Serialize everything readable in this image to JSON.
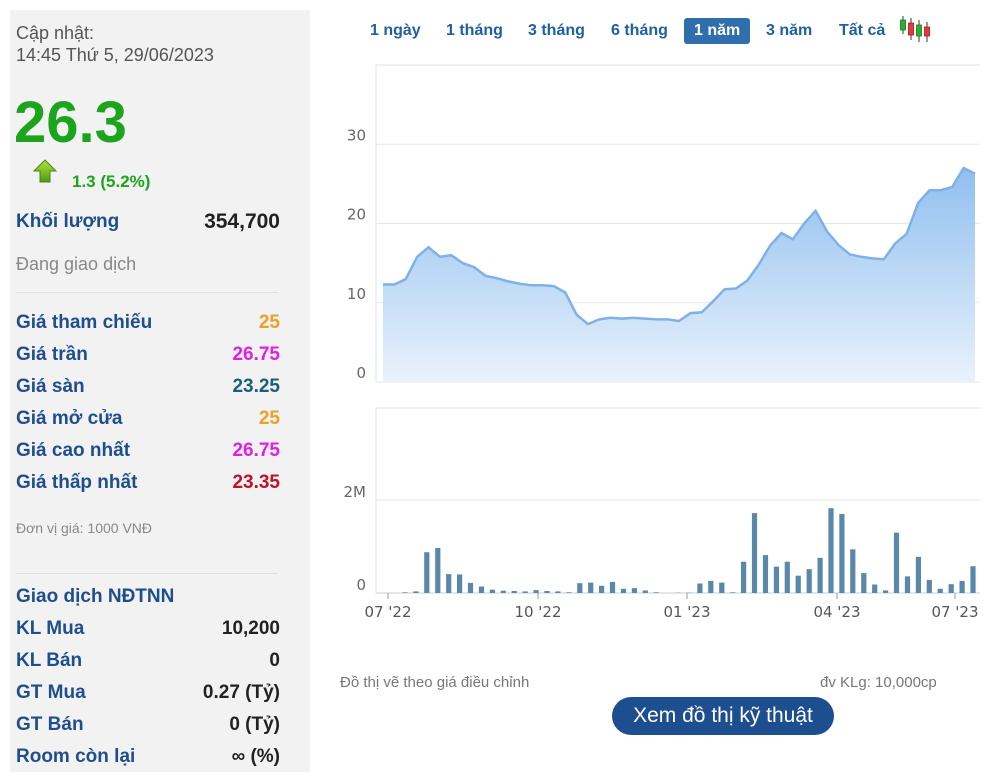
{
  "quote": {
    "updated_label": "Cập nhật:",
    "updated_time": "14:45 Thứ 5, 29/06/2023",
    "price": "26.3",
    "change": "1.3 (5.2%)",
    "volume_label": "Khối lượng",
    "volume": "354,700",
    "status": "Đang giao dịch",
    "unit_note": "Đơn vị giá: 1000 VNĐ",
    "colors": {
      "up": "#1ca51c",
      "reference": "#f0a020",
      "ceiling": "#e020e0",
      "floor": "#1a5f7a",
      "low": "#c0102a"
    }
  },
  "price_rows": [
    {
      "label": "Giá tham chiếu",
      "value": "25"
    },
    {
      "label": "Giá trần",
      "value": "26.75"
    },
    {
      "label": "Giá sàn",
      "value": "23.25"
    },
    {
      "label": "Giá mở cửa",
      "value": "25"
    },
    {
      "label": "Giá cao nhất",
      "value": "26.75"
    },
    {
      "label": "Giá thấp nhất",
      "value": "23.35"
    }
  ],
  "foreign": {
    "title": "Giao dịch NĐTNN",
    "rows": [
      {
        "label": "KL Mua",
        "value": "10,200"
      },
      {
        "label": "KL Bán",
        "value": "0"
      },
      {
        "label": "GT Mua",
        "value": "0.27 (Tỷ)"
      },
      {
        "label": "GT Bán",
        "value": "0 (Tỷ)"
      },
      {
        "label": "Room còn lại",
        "value": "∞ (%)"
      }
    ]
  },
  "tabs": [
    "1 ngày",
    "1 tháng",
    "3 tháng",
    "6 tháng",
    "1 năm",
    "3 năm",
    "Tất cả"
  ],
  "active_tab": "1 năm",
  "icons": {
    "chart_type": "candlestick-icon",
    "change": "arrow-up-icon"
  },
  "notes": {
    "adjusted": "Đồ thị vẽ theo giá điều chỉnh",
    "volume_unit": "đv KLg: 10,000cp"
  },
  "tech_button": "Xem đồ thị kỹ thuật",
  "chart_data": [
    {
      "type": "area",
      "ylim": [
        0,
        30
      ],
      "yticks": [
        "0",
        "10",
        "20",
        "30"
      ],
      "grid": true,
      "colors": {
        "line": "#7fb1e8",
        "fill": "#cfe3f8"
      },
      "x": [
        "07/22",
        "07/22",
        "08/22",
        "08/22",
        "08/22",
        "08/22",
        "08/22",
        "08/22",
        "09/22",
        "09/22",
        "09/22",
        "09/22",
        "09/22",
        "09/22",
        "10/22",
        "10/22",
        "10/22",
        "10/22",
        "10/22",
        "11/22",
        "11/22",
        "11/22",
        "11/22",
        "11/22",
        "12/22",
        "12/22",
        "12/22",
        "12/22",
        "12/22",
        "01/23",
        "01/23",
        "01/23",
        "01/23",
        "02/23",
        "02/23",
        "02/23",
        "02/23",
        "03/23",
        "03/23",
        "03/23",
        "03/23",
        "04/23",
        "04/23",
        "04/23",
        "04/23",
        "05/23",
        "05/23",
        "05/23",
        "05/23",
        "06/23",
        "06/23",
        "06/23",
        "06/23",
        "06/23",
        "06/23"
      ],
      "values": [
        12.3,
        12.3,
        13,
        15.8,
        17,
        15.8,
        16,
        15,
        14.5,
        13.4,
        13.1,
        12.7,
        12.4,
        12.2,
        12.2,
        12.1,
        11.3,
        8.5,
        7.3,
        7.9,
        8.1,
        8,
        8.1,
        8,
        7.9,
        7.9,
        7.7,
        8.7,
        8.8,
        10.2,
        11.7,
        11.8,
        12.8,
        14.8,
        17.2,
        18.8,
        18,
        20,
        21.6,
        19,
        17.3,
        16.1,
        15.8,
        15.6,
        15.5,
        17.5,
        18.7,
        22.6,
        24.2,
        24.2,
        24.6,
        27,
        26.3
      ],
      "series": []
    },
    {
      "type": "bar",
      "ylim": [
        0,
        3.2
      ],
      "yticks": [
        "0",
        "2M"
      ],
      "xticks": [
        "07 '22",
        "10 '22",
        "01 '23",
        "04 '23",
        "07 '23"
      ],
      "colors": {
        "bar": "#5a88a8"
      },
      "values": [
        0.02,
        0.05,
        1.25,
        1.38,
        0.58,
        0.57,
        0.31,
        0.2,
        0.1,
        0.07,
        0.06,
        0.05,
        0.09,
        0.06,
        0.05,
        0.02,
        0.3,
        0.32,
        0.22,
        0.34,
        0.13,
        0.15,
        0.08,
        0.02,
        0,
        0.01,
        0.01,
        0.29,
        0.37,
        0.32,
        0.02,
        0.96,
        2.45,
        1.16,
        0.81,
        0.96,
        0.53,
        0.73,
        1.08,
        2.6,
        2.42,
        1.34,
        0.61,
        0.26,
        0.08,
        1.85,
        0.51,
        1.11,
        0.4,
        0.13,
        0.27,
        0.37,
        0.82
      ]
    }
  ]
}
